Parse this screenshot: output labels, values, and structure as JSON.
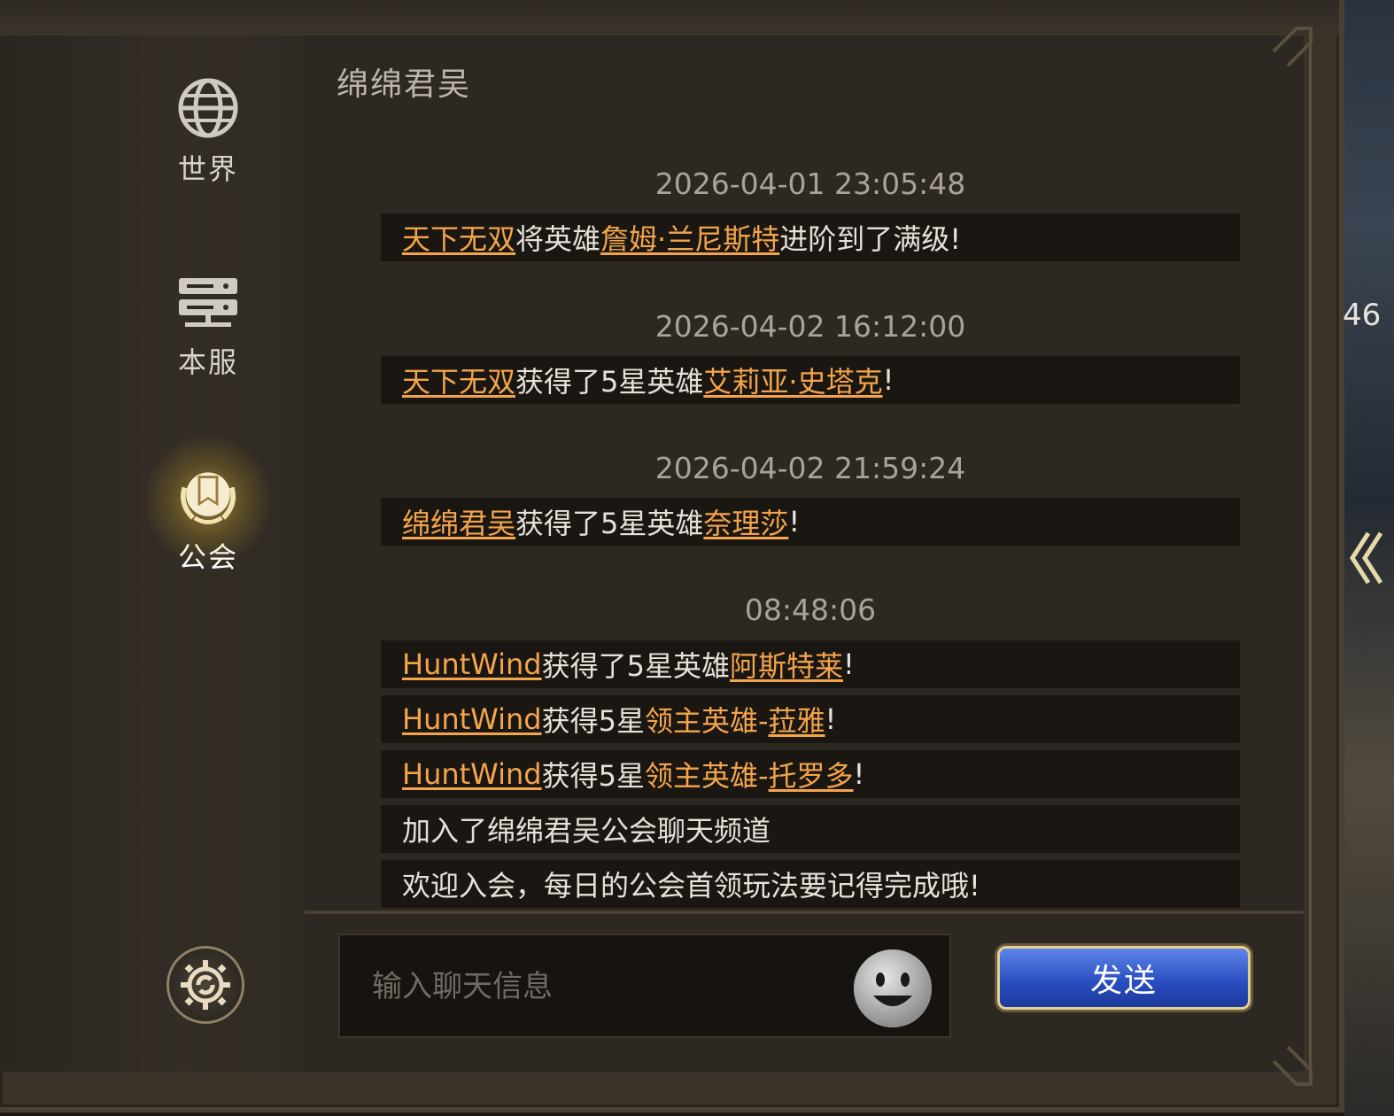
{
  "sidebar": {
    "tabs": [
      {
        "label": "世界",
        "icon": "globe-icon"
      },
      {
        "label": "本服",
        "icon": "server-icon"
      },
      {
        "label": "公会",
        "icon": "guild-emblem-icon",
        "active": true
      }
    ],
    "settings_icon": "settings-gear-icon"
  },
  "chat": {
    "channel_title": "绵绵君吴",
    "timestamps": [
      "2026-04-01 23:05:48",
      "2026-04-02 16:12:00",
      "2026-04-02 21:59:24",
      "08:48:06"
    ],
    "messages": [
      {
        "parts": [
          {
            "t": "天下无双",
            "s": "link"
          },
          {
            "t": "将英雄",
            "s": "text"
          },
          {
            "t": "詹姆·兰尼斯特",
            "s": "link"
          },
          {
            "t": "进阶到了满级!",
            "s": "text"
          }
        ]
      },
      {
        "parts": [
          {
            "t": "天下无双",
            "s": "link"
          },
          {
            "t": "获得了5星英雄",
            "s": "text"
          },
          {
            "t": "艾莉亚·史塔克",
            "s": "link"
          },
          {
            "t": "!",
            "s": "text"
          }
        ]
      },
      {
        "parts": [
          {
            "t": "绵绵君吴",
            "s": "link"
          },
          {
            "t": "获得了5星英雄",
            "s": "text"
          },
          {
            "t": "奈理莎",
            "s": "link"
          },
          {
            "t": "!",
            "s": "text"
          }
        ]
      },
      {
        "parts": [
          {
            "t": "HuntWind",
            "s": "link"
          },
          {
            "t": "获得了5星英雄",
            "s": "text"
          },
          {
            "t": "阿斯特莱",
            "s": "link"
          },
          {
            "t": "!",
            "s": "text"
          }
        ]
      },
      {
        "parts": [
          {
            "t": "HuntWind",
            "s": "link"
          },
          {
            "t": "获得5星",
            "s": "text"
          },
          {
            "t": "领主英雄-",
            "s": "hl"
          },
          {
            "t": "菈雅",
            "s": "link"
          },
          {
            "t": "!",
            "s": "text"
          }
        ]
      },
      {
        "parts": [
          {
            "t": "HuntWind",
            "s": "link"
          },
          {
            "t": "获得5星",
            "s": "text"
          },
          {
            "t": "领主英雄-",
            "s": "hl"
          },
          {
            "t": "托罗多",
            "s": "link"
          },
          {
            "t": "!",
            "s": "text"
          }
        ]
      },
      {
        "parts": [
          {
            "t": "加入了绵绵君吴公会聊天频道",
            "s": "text"
          }
        ]
      },
      {
        "parts": [
          {
            "t": "欢迎入会，每日的公会首领玩法要记得完成哦!",
            "s": "text"
          }
        ]
      }
    ]
  },
  "composer": {
    "placeholder": "输入聊天信息",
    "value": "",
    "emoji_icon": "smiley-face-icon",
    "send_label": "发送"
  },
  "right_edge": {
    "number": "46",
    "collapse_icon": "double-chevron-left-icon"
  },
  "colors": {
    "link": "#f4a44a",
    "text": "#e6e2da",
    "timestamp": "#a9a398",
    "send_button": "#2a4fc2"
  }
}
